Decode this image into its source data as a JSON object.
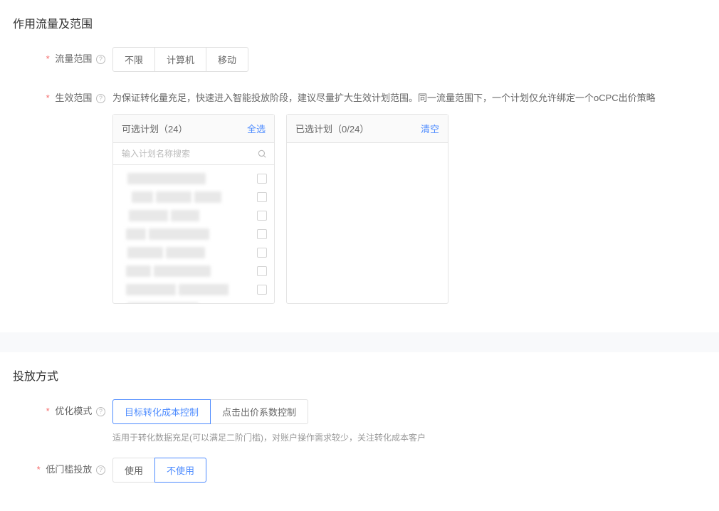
{
  "section1": {
    "title": "作用流量及范围",
    "traffic_scope": {
      "label": "流量范围",
      "options": [
        "不限",
        "计算机",
        "移动"
      ]
    },
    "effective_scope": {
      "label": "生效范围",
      "hint": "为保证转化量充足，快速进入智能投放阶段，建议尽量扩大生效计划范围。同一流量范围下，一个计划仅允许绑定一个oCPC出价策略",
      "available": {
        "header": "可选计划（24）",
        "action": "全选",
        "search_placeholder": "输入计划名称搜索"
      },
      "selected": {
        "header": "已选计划（0/24）",
        "action": "清空"
      }
    }
  },
  "section2": {
    "title": "投放方式",
    "optimization_mode": {
      "label": "优化模式",
      "options": [
        "目标转化成本控制",
        "点击出价系数控制"
      ],
      "hint": "适用于转化数据充足(可以满足二阶门槛)，对账户操作需求较少，关注转化成本客户"
    },
    "low_threshold": {
      "label": "低门槛投放",
      "options": [
        "使用",
        "不使用"
      ]
    }
  }
}
